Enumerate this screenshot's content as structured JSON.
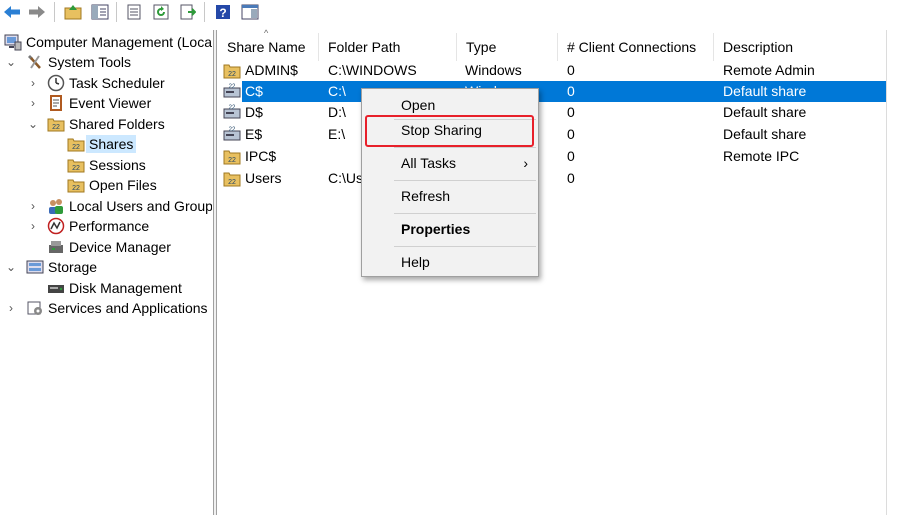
{
  "tree": {
    "root": "Computer Management (Local",
    "items": [
      {
        "label": "System Tools"
      },
      {
        "label": "Task Scheduler"
      },
      {
        "label": "Event Viewer"
      },
      {
        "label": "Shared Folders"
      },
      {
        "label": "Shares"
      },
      {
        "label": "Sessions"
      },
      {
        "label": "Open Files"
      },
      {
        "label": "Local Users and Groups"
      },
      {
        "label": "Performance"
      },
      {
        "label": "Device Manager"
      },
      {
        "label": "Storage"
      },
      {
        "label": "Disk Management"
      },
      {
        "label": "Services and Applications"
      }
    ]
  },
  "columns": [
    "Share Name",
    "Folder Path",
    "Type",
    "# Client Connections",
    "Description"
  ],
  "rows": [
    {
      "name": "ADMIN$",
      "path": "C:\\WINDOWS",
      "type": "Windows",
      "connections": "0",
      "description": "Remote Admin"
    },
    {
      "name": "C$",
      "path": "C:\\",
      "type": "Windows",
      "connections": "0",
      "description": "Default share"
    },
    {
      "name": "D$",
      "path": "D:\\",
      "type": "",
      "connections": "0",
      "description": "Default share"
    },
    {
      "name": "E$",
      "path": "E:\\",
      "type": "",
      "connections": "0",
      "description": "Default share"
    },
    {
      "name": "IPC$",
      "path": "",
      "type": "",
      "connections": "0",
      "description": "Remote IPC"
    },
    {
      "name": "Users",
      "path": "C:\\Us",
      "type": "",
      "connections": "0",
      "description": ""
    }
  ],
  "context_menu": {
    "open": "Open",
    "stop_sharing": "Stop Sharing",
    "all_tasks": "All Tasks",
    "all_tasks_arrow": "›",
    "refresh": "Refresh",
    "properties": "Properties",
    "help": "Help"
  },
  "colors": {
    "selection": "#0078d7",
    "highlight_box": "#e8202a"
  }
}
